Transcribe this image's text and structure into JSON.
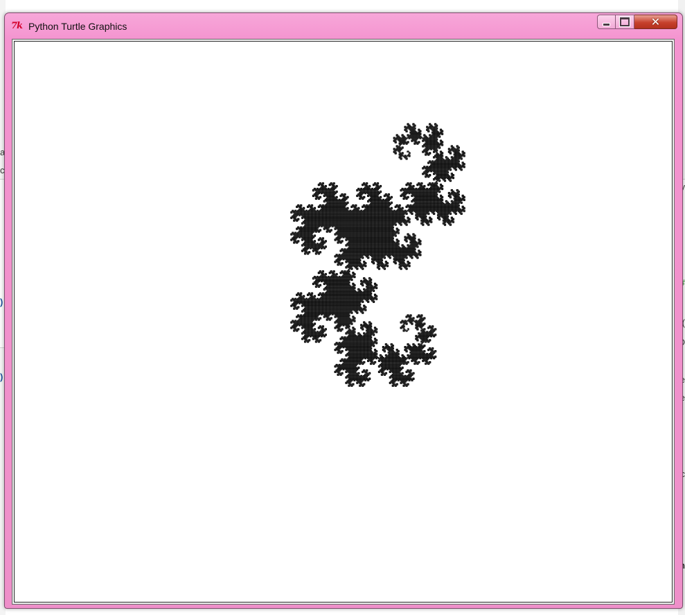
{
  "window": {
    "title": "Python Turtle Graphics",
    "app_icon": "tk-feather-icon",
    "icon_text": "7k"
  },
  "controls": {
    "minimize": "minimize-icon",
    "maximize": "maximize-icon",
    "close": "close-icon"
  },
  "canvas": {
    "drawing": "fractal-dragon-curve",
    "pen_color": "#000000",
    "background": "#ffffff"
  },
  "background_fragments": [
    "a",
    "c",
    ")",
    ")",
    "y",
    "#",
    "(",
    "D",
    "e",
    "e",
    "c",
    "m"
  ],
  "colors": {
    "titlebar": "#f493cf",
    "close_button": "#c7412d",
    "icon_red": "#d4002b"
  }
}
